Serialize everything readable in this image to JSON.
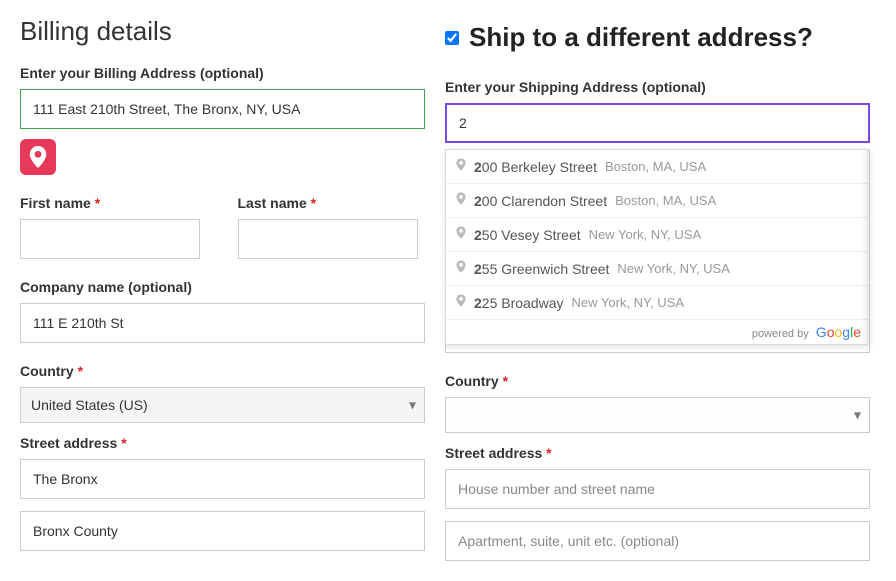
{
  "billing": {
    "heading": "Billing details",
    "enter_label": "Enter your Billing Address (optional)",
    "enter_value": "111 East 210th Street, The Bronx, NY, USA",
    "first_name_label": "First name",
    "last_name_label": "Last name",
    "company_label": "Company name (optional)",
    "company_value": "111 E 210th St",
    "country_label": "Country",
    "country_value": "United States (US)",
    "street_label": "Street address",
    "street_value1": "The Bronx",
    "street_value2": "Bronx County"
  },
  "shipping": {
    "checkbox_checked": true,
    "heading": "Ship to a different address?",
    "enter_label": "Enter your Shipping Address (optional)",
    "enter_value": "2",
    "country_label": "Country",
    "country_value": "",
    "street_label": "Street address",
    "street_ph1": "House number and street name",
    "street_ph2": "Apartment, suite, unit etc. (optional)",
    "suggestions": [
      {
        "bold": "2",
        "rest": "00 Berkeley Street",
        "secondary": "Boston, MA, USA"
      },
      {
        "bold": "2",
        "rest": "00 Clarendon Street",
        "secondary": "Boston, MA, USA"
      },
      {
        "bold": "2",
        "rest": "50 Vesey Street",
        "secondary": "New York, NY, USA"
      },
      {
        "bold": "2",
        "rest": "55 Greenwich Street",
        "secondary": "New York, NY, USA"
      },
      {
        "bold": "2",
        "rest": "25 Broadway",
        "secondary": "New York, NY, USA"
      }
    ],
    "powered_by": "powered by"
  },
  "asterisk": "*"
}
